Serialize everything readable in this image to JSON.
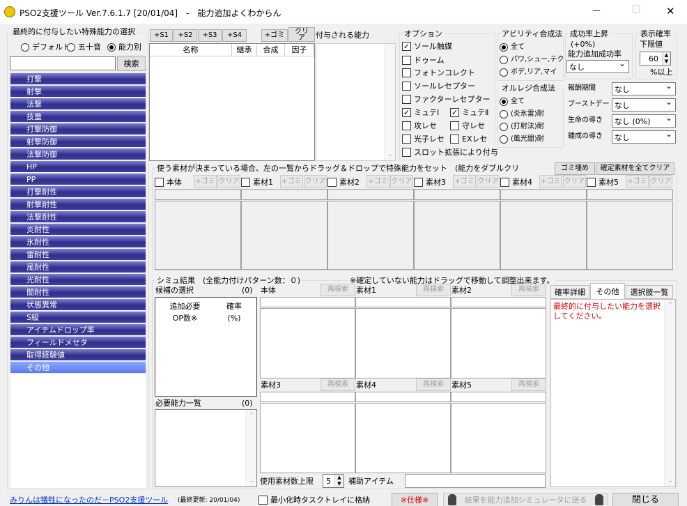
{
  "window": {
    "title": "PSO2支援ツール Ver.7.6.1.7 [20/01/04]　-　能力追加よくわからん",
    "minimize": "—",
    "maximize": "☐",
    "close": "✕"
  },
  "left": {
    "group_label": "最終的に付与したい特殊能力の選択",
    "sort_options": [
      {
        "label": "デフォルト",
        "checked": false
      },
      {
        "label": "五十音",
        "checked": false
      },
      {
        "label": "能力別",
        "checked": true
      }
    ],
    "search_value": "",
    "search_button": "検索",
    "abilities": [
      "打撃",
      "射撃",
      "法撃",
      "技量",
      "打撃防御",
      "射撃防御",
      "法撃防御",
      "HP",
      "PP",
      "打撃耐性",
      "射撃耐性",
      "法撃耐性",
      "炎耐性",
      "氷耐性",
      "雷耐性",
      "風耐性",
      "光耐性",
      "闇耐性",
      "状態異常",
      "S級",
      "アイテムドロップ率",
      "フィールドメセタ",
      "取得経験値",
      "その他"
    ],
    "selected_ability": "その他"
  },
  "slot_buttons": [
    "+S1",
    "+S2",
    "+S3",
    "+S4"
  ],
  "gomi_button": "+ゴミ",
  "clear_button": "クリア",
  "result_table": {
    "headers": [
      "名称",
      "継承",
      "合成",
      "因子"
    ]
  },
  "granted_label": "付与される能力",
  "options": {
    "label": "オプション",
    "items": [
      {
        "label": "ソール触媒",
        "checked": true
      },
      {
        "label": "ドゥーム",
        "checked": false
      },
      {
        "label": "フォトンコレクト",
        "checked": false
      },
      {
        "label": "ソールレセプター",
        "checked": false
      },
      {
        "label": "ファクターレセプター",
        "checked": false
      },
      {
        "label": "ミュテⅠ",
        "checked": true
      },
      {
        "label": "ミュテⅡ",
        "checked": true
      },
      {
        "label": "攻レセ",
        "checked": false
      },
      {
        "label": "守レセ",
        "checked": false
      },
      {
        "label": "光子レセ",
        "checked": false
      },
      {
        "label": "EXレセ",
        "checked": false
      },
      {
        "label": "スロット拡張により付与",
        "checked": false
      }
    ]
  },
  "ability_synth": {
    "label": "アビリティ合成法",
    "options": [
      {
        "label": "全て",
        "checked": true
      },
      {
        "label": "パワ,シュー,テク",
        "checked": false
      },
      {
        "label": "ボデ,リア,マイ",
        "checked": false
      }
    ]
  },
  "orage_synth": {
    "label": "オルレジ合成法",
    "options": [
      {
        "label": "全て",
        "checked": true
      },
      {
        "label": "(炎氷雷)耐",
        "checked": false
      },
      {
        "label": "(打射法)耐",
        "checked": false
      },
      {
        "label": "(風光闇)耐",
        "checked": false
      }
    ]
  },
  "success_up": {
    "label": "成功率上昇",
    "value": "(+0%)",
    "bonus_label": "能力追加成功率",
    "bonus_value": "なし"
  },
  "display_rate": {
    "label": "表示確率",
    "sub": "下限値",
    "value": "60",
    "unit": "%以上"
  },
  "boosts": [
    {
      "label": "報酬期間",
      "value": "なし"
    },
    {
      "label": "ブーストデー",
      "value": "なし"
    },
    {
      "label": "生命の導き",
      "value": "なし (0%)"
    },
    {
      "label": "鍾成の導き",
      "value": "なし"
    }
  ],
  "material": {
    "group_label": "使う素材が決まっている場合、左の一覧からドラッグ＆ドロップで特殊能力をセット　(能力をダブルクリ",
    "fill_gomi": "ゴミ埋め",
    "clear_all": "確定素材を全てクリア",
    "slots": [
      {
        "label": "本体"
      },
      {
        "label": "素材1"
      },
      {
        "label": "素材2"
      },
      {
        "label": "素材3"
      },
      {
        "label": "素材4"
      },
      {
        "label": "素材5"
      }
    ],
    "gomi": "+ゴミ",
    "clear": "クリア"
  },
  "sim": {
    "label": "シミュ結果　(全能力付けパターン数：０)",
    "note": "※確定していない能力はドラッグで移動して調整出来ます。",
    "candidates_label": "候補の選択",
    "candidates_count": "(0)",
    "cand_header1": "追加必要\nOP数※",
    "cand_header2": "確率\n(%)",
    "required_label": "必要能力一覧",
    "required_count": "(0)",
    "panels": [
      {
        "label": "本体"
      },
      {
        "label": "素材1"
      },
      {
        "label": "素材2"
      },
      {
        "label": "素材3"
      },
      {
        "label": "素材4"
      },
      {
        "label": "素材5"
      }
    ],
    "research": "再検索",
    "max_materials_label": "使用素材数上限",
    "max_materials_value": "5",
    "assist_item_label": "補助アイテム",
    "assist_item_value": ""
  },
  "detail_tabs": [
    {
      "label": "確率詳細",
      "active": false
    },
    {
      "label": "その他",
      "active": true
    },
    {
      "label": "選択肢一覧",
      "active": false
    }
  ],
  "detail_message": "最終的に付与したい能力を選択してください。",
  "footer": {
    "link": "みりんは犠牲になったのだ－PSO2支援ツール",
    "updated": "(最終更新: 20/01/04)",
    "tray_label": "最小化時タスクトレイに格納",
    "spec_button": "※仕様※",
    "send_button": "結果を能力追加シミュレータに送る",
    "close_button": "閉じる"
  }
}
